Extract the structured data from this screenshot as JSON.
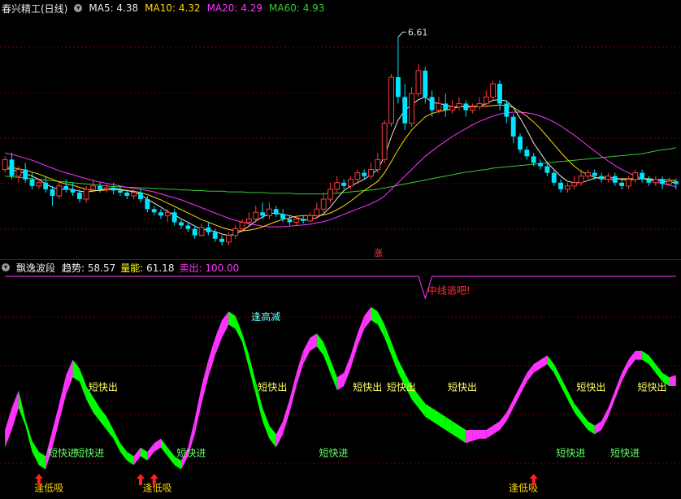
{
  "colors": {
    "bg": "#000000",
    "up": "#ff3b3b",
    "down": "#00e5ff",
    "ma5": "#e8e8e8",
    "ma10": "#ffd700",
    "ma20": "#ff33ff",
    "ma60": "#33cc33",
    "grid": "#7a0000",
    "pink": "#ff33ff",
    "green": "#00ff00"
  },
  "main_panel": {
    "title": "春兴精工(日线)",
    "ma_labels": [
      {
        "label": "MA5: 4.38",
        "color": "#e8e8e8"
      },
      {
        "label": "MA10: 4.32",
        "color": "#ffd700"
      },
      {
        "label": "MA20: 4.29",
        "color": "#ff33ff"
      },
      {
        "label": "MA60: 4.93",
        "color": "#33cc33"
      }
    ],
    "peak_label": "6.61",
    "zhang_label": "涨"
  },
  "sub_panel": {
    "title": "飘逸波段",
    "indicators": [
      {
        "label": "趋势: ",
        "value": "58.57",
        "color": "#ffffff",
        "vcolor": "#e8e8e8"
      },
      {
        "label": "量能: ",
        "value": "61.18",
        "color": "#ffff00",
        "vcolor": "#e8e8e8"
      },
      {
        "label": "卖出: ",
        "value": "100.00",
        "color": "#ff33ff",
        "vcolor": "#ff33ff"
      }
    ]
  },
  "chart_data": {
    "type": "candlestick",
    "peak_value": 6.61,
    "candles": [
      [
        4.6,
        4.75,
        4.55,
        4.8
      ],
      [
        4.75,
        4.5,
        4.45,
        4.85
      ],
      [
        4.5,
        4.6,
        4.4,
        4.65
      ],
      [
        4.6,
        4.45,
        4.4,
        4.7
      ],
      [
        4.45,
        4.35,
        4.3,
        4.55
      ],
      [
        4.35,
        4.4,
        4.3,
        4.45
      ],
      [
        4.4,
        4.3,
        4.25,
        4.5
      ],
      [
        4.3,
        4.2,
        4.05,
        4.35
      ],
      [
        4.2,
        4.35,
        4.15,
        4.4
      ],
      [
        4.35,
        4.3,
        4.25,
        4.45
      ],
      [
        4.3,
        4.25,
        4.2,
        4.4
      ],
      [
        4.25,
        4.15,
        4.1,
        4.3
      ],
      [
        4.15,
        4.3,
        4.1,
        4.35
      ],
      [
        4.3,
        4.35,
        4.25,
        4.45
      ],
      [
        4.35,
        4.3,
        4.25,
        4.4
      ],
      [
        4.3,
        4.32,
        4.25,
        4.38
      ],
      [
        4.32,
        4.28,
        4.22,
        4.4
      ],
      [
        4.28,
        4.25,
        4.2,
        4.35
      ],
      [
        4.25,
        4.2,
        4.15,
        4.3
      ],
      [
        4.2,
        4.25,
        4.15,
        4.3
      ],
      [
        4.25,
        4.15,
        4.1,
        4.3
      ],
      [
        4.15,
        4.0,
        3.95,
        4.2
      ],
      [
        4.0,
        3.95,
        3.9,
        4.05
      ],
      [
        3.95,
        3.9,
        3.85,
        4.0
      ],
      [
        3.9,
        3.95,
        3.8,
        4.0
      ],
      [
        3.95,
        3.8,
        3.75,
        4.0
      ],
      [
        3.8,
        3.75,
        3.7,
        3.85
      ],
      [
        3.75,
        3.7,
        3.65,
        3.8
      ],
      [
        3.7,
        3.6,
        3.55,
        3.75
      ],
      [
        3.6,
        3.72,
        3.58,
        3.78
      ],
      [
        3.72,
        3.65,
        3.6,
        3.8
      ],
      [
        3.65,
        3.55,
        3.5,
        3.7
      ],
      [
        3.55,
        3.5,
        3.45,
        3.6
      ],
      [
        3.5,
        3.6,
        3.45,
        3.65
      ],
      [
        3.6,
        3.7,
        3.55,
        3.75
      ],
      [
        3.7,
        3.8,
        3.65,
        3.85
      ],
      [
        3.8,
        3.85,
        3.75,
        3.95
      ],
      [
        3.85,
        3.95,
        3.8,
        4.05
      ],
      [
        3.95,
        3.9,
        3.85,
        4.1
      ],
      [
        3.9,
        4.0,
        3.85,
        4.1
      ],
      [
        4.0,
        3.92,
        3.88,
        4.05
      ],
      [
        3.92,
        3.85,
        3.8,
        4.0
      ],
      [
        3.85,
        3.8,
        3.75,
        3.9
      ],
      [
        3.8,
        3.85,
        3.75,
        3.9
      ],
      [
        3.85,
        3.82,
        3.78,
        3.9
      ],
      [
        3.82,
        3.9,
        3.8,
        3.95
      ],
      [
        3.9,
        4.0,
        3.85,
        4.1
      ],
      [
        4.0,
        4.15,
        3.95,
        4.25
      ],
      [
        4.15,
        4.3,
        4.1,
        4.4
      ],
      [
        4.3,
        4.4,
        4.25,
        4.5
      ],
      [
        4.4,
        4.35,
        4.3,
        4.45
      ],
      [
        4.35,
        4.45,
        4.3,
        4.5
      ],
      [
        4.45,
        4.55,
        4.4,
        4.6
      ],
      [
        4.55,
        4.5,
        4.45,
        4.6
      ],
      [
        4.5,
        4.6,
        4.45,
        4.7
      ],
      [
        4.6,
        4.75,
        4.55,
        4.85
      ],
      [
        4.75,
        5.3,
        4.7,
        5.35
      ],
      [
        5.3,
        6.0,
        5.25,
        6.05
      ],
      [
        6.0,
        5.7,
        5.6,
        6.61
      ],
      [
        5.7,
        5.3,
        5.2,
        5.9
      ],
      [
        5.3,
        5.75,
        5.25,
        5.85
      ],
      [
        5.75,
        6.1,
        5.7,
        6.2
      ],
      [
        6.1,
        5.7,
        5.6,
        6.15
      ],
      [
        5.7,
        5.5,
        5.4,
        5.8
      ],
      [
        5.5,
        5.6,
        5.45,
        5.7
      ],
      [
        5.6,
        5.5,
        5.4,
        5.75
      ],
      [
        5.5,
        5.55,
        5.45,
        5.65
      ],
      [
        5.55,
        5.6,
        5.5,
        5.7
      ],
      [
        5.6,
        5.5,
        5.4,
        5.65
      ],
      [
        5.5,
        5.55,
        5.45,
        5.6
      ],
      [
        5.55,
        5.6,
        5.5,
        5.7
      ],
      [
        5.6,
        5.7,
        5.55,
        5.8
      ],
      [
        5.7,
        5.9,
        5.65,
        5.95
      ],
      [
        5.9,
        5.6,
        5.5,
        5.95
      ],
      [
        5.6,
        5.4,
        5.3,
        5.65
      ],
      [
        5.4,
        5.1,
        5.0,
        5.45
      ],
      [
        5.1,
        4.9,
        4.85,
        5.15
      ],
      [
        4.9,
        4.8,
        4.75,
        4.95
      ],
      [
        4.8,
        4.7,
        4.65,
        4.85
      ],
      [
        4.7,
        4.65,
        4.6,
        4.75
      ],
      [
        4.65,
        4.55,
        4.5,
        4.7
      ],
      [
        4.55,
        4.4,
        4.35,
        4.6
      ],
      [
        4.4,
        4.3,
        4.25,
        4.45
      ],
      [
        4.3,
        4.35,
        4.25,
        4.4
      ],
      [
        4.35,
        4.4,
        4.3,
        4.5
      ],
      [
        4.4,
        4.5,
        4.35,
        4.6
      ],
      [
        4.5,
        4.55,
        4.45,
        4.6
      ],
      [
        4.55,
        4.5,
        4.45,
        4.6
      ],
      [
        4.5,
        4.45,
        4.4,
        4.55
      ],
      [
        4.45,
        4.5,
        4.4,
        4.55
      ],
      [
        4.5,
        4.4,
        4.35,
        4.55
      ],
      [
        4.4,
        4.35,
        4.3,
        4.45
      ],
      [
        4.35,
        4.45,
        4.3,
        4.5
      ],
      [
        4.45,
        4.55,
        4.4,
        4.6
      ],
      [
        4.55,
        4.45,
        4.4,
        4.6
      ],
      [
        4.45,
        4.4,
        4.35,
        4.5
      ],
      [
        4.4,
        4.45,
        4.35,
        4.5
      ],
      [
        4.45,
        4.38,
        4.3,
        4.5
      ],
      [
        4.38,
        4.42,
        4.35,
        4.48
      ],
      [
        4.42,
        4.38,
        4.3,
        4.46
      ]
    ],
    "ma5": [
      4.62,
      4.6,
      4.57,
      4.54,
      4.5,
      4.45,
      4.38,
      4.33,
      4.3,
      4.3,
      4.3,
      4.27,
      4.26,
      4.27,
      4.29,
      4.31,
      4.32,
      4.3,
      4.28,
      4.26,
      4.22,
      4.15,
      4.09,
      4.03,
      3.96,
      3.91,
      3.85,
      3.8,
      3.74,
      3.7,
      3.68,
      3.66,
      3.62,
      3.6,
      3.62,
      3.67,
      3.74,
      3.82,
      3.88,
      3.93,
      3.94,
      3.92,
      3.9,
      3.87,
      3.84,
      3.84,
      3.87,
      3.93,
      4.03,
      4.16,
      4.28,
      4.35,
      4.4,
      4.45,
      4.52,
      4.6,
      4.8,
      5.1,
      5.35,
      5.5,
      5.58,
      5.66,
      5.7,
      5.62,
      5.6,
      5.58,
      5.55,
      5.55,
      5.55,
      5.55,
      5.56,
      5.6,
      5.65,
      5.66,
      5.64,
      5.54,
      5.38,
      5.2,
      5.0,
      4.85,
      4.7,
      4.6,
      4.5,
      4.42,
      4.4,
      4.4,
      4.43,
      4.47,
      4.48,
      4.48,
      4.47,
      4.45,
      4.44,
      4.45,
      4.46,
      4.45,
      4.44,
      4.42,
      4.41,
      4.4
    ],
    "ma10": [
      4.64,
      4.63,
      4.61,
      4.59,
      4.56,
      4.53,
      4.49,
      4.45,
      4.41,
      4.38,
      4.36,
      4.33,
      4.3,
      4.28,
      4.28,
      4.29,
      4.3,
      4.29,
      4.28,
      4.27,
      4.25,
      4.22,
      4.18,
      4.14,
      4.09,
      4.04,
      3.99,
      3.94,
      3.89,
      3.84,
      3.8,
      3.76,
      3.72,
      3.69,
      3.67,
      3.67,
      3.68,
      3.7,
      3.73,
      3.77,
      3.81,
      3.84,
      3.87,
      3.89,
      3.9,
      3.9,
      3.9,
      3.91,
      3.94,
      3.99,
      4.05,
      4.12,
      4.2,
      4.28,
      4.35,
      4.42,
      4.55,
      4.72,
      4.9,
      5.06,
      5.2,
      5.3,
      5.4,
      5.45,
      5.48,
      5.5,
      5.52,
      5.55,
      5.56,
      5.56,
      5.56,
      5.56,
      5.57,
      5.58,
      5.57,
      5.54,
      5.48,
      5.41,
      5.32,
      5.22,
      5.1,
      4.98,
      4.86,
      4.75,
      4.65,
      4.57,
      4.52,
      4.48,
      4.46,
      4.45,
      4.45,
      4.46,
      4.46,
      4.46,
      4.46,
      4.46,
      4.45,
      4.45,
      4.44,
      4.43
    ],
    "ma20": [
      4.85,
      4.83,
      4.8,
      4.77,
      4.74,
      4.7,
      4.66,
      4.62,
      4.58,
      4.55,
      4.52,
      4.49,
      4.46,
      4.43,
      4.41,
      4.39,
      4.37,
      4.35,
      4.33,
      4.31,
      4.3,
      4.28,
      4.26,
      4.23,
      4.2,
      4.17,
      4.14,
      4.1,
      4.06,
      4.02,
      3.98,
      3.94,
      3.9,
      3.86,
      3.83,
      3.8,
      3.78,
      3.76,
      3.74,
      3.73,
      3.73,
      3.73,
      3.74,
      3.75,
      3.76,
      3.77,
      3.79,
      3.81,
      3.84,
      3.88,
      3.92,
      3.96,
      4.0,
      4.04,
      4.08,
      4.13,
      4.2,
      4.3,
      4.4,
      4.5,
      4.6,
      4.7,
      4.8,
      4.88,
      4.96,
      5.03,
      5.1,
      5.16,
      5.22,
      5.28,
      5.33,
      5.37,
      5.41,
      5.44,
      5.46,
      5.47,
      5.47,
      5.46,
      5.44,
      5.41,
      5.37,
      5.32,
      5.26,
      5.19,
      5.12,
      5.04,
      4.96,
      4.88,
      4.8,
      4.73,
      4.66,
      4.6,
      4.55,
      4.5,
      4.47,
      4.44,
      4.41,
      4.39,
      4.36,
      4.34
    ],
    "ma60": [
      4.5,
      4.49,
      4.48,
      4.47,
      4.46,
      4.45,
      4.44,
      4.43,
      4.42,
      4.41,
      4.4,
      4.39,
      4.38,
      4.37,
      4.36,
      4.35,
      4.34,
      4.34,
      4.33,
      4.33,
      4.32,
      4.32,
      4.31,
      4.31,
      4.3,
      4.3,
      4.29,
      4.29,
      4.28,
      4.28,
      4.27,
      4.27,
      4.27,
      4.26,
      4.26,
      4.26,
      4.25,
      4.25,
      4.25,
      4.24,
      4.24,
      4.24,
      4.24,
      4.23,
      4.23,
      4.23,
      4.23,
      4.23,
      4.24,
      4.24,
      4.25,
      4.26,
      4.27,
      4.28,
      4.29,
      4.3,
      4.32,
      4.34,
      4.36,
      4.38,
      4.4,
      4.42,
      4.44,
      4.46,
      4.48,
      4.5,
      4.52,
      4.54,
      4.56,
      4.57,
      4.59,
      4.6,
      4.62,
      4.63,
      4.64,
      4.65,
      4.66,
      4.67,
      4.68,
      4.69,
      4.7,
      4.71,
      4.72,
      4.73,
      4.74,
      4.75,
      4.76,
      4.77,
      4.78,
      4.79,
      4.8,
      4.81,
      4.82,
      4.83,
      4.84,
      4.86,
      4.88,
      4.9,
      4.91,
      4.93
    ],
    "y_range": [
      3.3,
      6.9
    ],
    "indicator": {
      "y_range": [
        0,
        100
      ],
      "trend": [
        30,
        40,
        48,
        35,
        25,
        20,
        18,
        30,
        42,
        55,
        62,
        58,
        50,
        45,
        40,
        36,
        30,
        24,
        20,
        18,
        22,
        20,
        24,
        26,
        22,
        18,
        16,
        22,
        35,
        50,
        62,
        72,
        80,
        84,
        82,
        74,
        64,
        52,
        40,
        32,
        28,
        34,
        44,
        56,
        66,
        72,
        74,
        70,
        62,
        54,
        56,
        64,
        74,
        82,
        86,
        84,
        78,
        70,
        62,
        56,
        50,
        46,
        42,
        40,
        38,
        36,
        34,
        32,
        30,
        30,
        30,
        30,
        32,
        34,
        38,
        44,
        50,
        56,
        60,
        62,
        64,
        60,
        54,
        48,
        42,
        38,
        34,
        32,
        34,
        40,
        48,
        56,
        62,
        66,
        66,
        64,
        60,
        56,
        54,
        55
      ],
      "energy": [
        22,
        30,
        40,
        32,
        20,
        14,
        12,
        22,
        34,
        46,
        54,
        52,
        44,
        38,
        34,
        30,
        26,
        20,
        16,
        14,
        18,
        16,
        20,
        22,
        18,
        14,
        12,
        18,
        28,
        42,
        54,
        64,
        72,
        78,
        76,
        70,
        58,
        46,
        34,
        26,
        22,
        28,
        38,
        50,
        60,
        66,
        68,
        64,
        56,
        48,
        50,
        58,
        68,
        76,
        80,
        78,
        72,
        64,
        56,
        50,
        44,
        40,
        36,
        34,
        32,
        30,
        28,
        26,
        24,
        25,
        26,
        26,
        28,
        30,
        34,
        40,
        46,
        52,
        56,
        58,
        60,
        56,
        50,
        44,
        38,
        34,
        30,
        28,
        30,
        36,
        44,
        52,
        58,
        62,
        62,
        60,
        56,
        52,
        50,
        50
      ],
      "sell_line": [
        100,
        100,
        100,
        100,
        100,
        100,
        100,
        100,
        100,
        100,
        100,
        100,
        100,
        100,
        100,
        100,
        100,
        100,
        100,
        100,
        100,
        100,
        100,
        100,
        100,
        100,
        100,
        100,
        100,
        100,
        100,
        100,
        100,
        100,
        100,
        100,
        100,
        100,
        100,
        100,
        100,
        100,
        100,
        100,
        100,
        100,
        100,
        100,
        100,
        100,
        100,
        100,
        100,
        100,
        100,
        100,
        100,
        100,
        100,
        100,
        100,
        100,
        90,
        100,
        100,
        100,
        100,
        100,
        100,
        100,
        100,
        100,
        100,
        100,
        100,
        100,
        100,
        100,
        100,
        100,
        100,
        100,
        100,
        100,
        100,
        100,
        100,
        100,
        100,
        100,
        100,
        100,
        100,
        100,
        100,
        100,
        100,
        100,
        100,
        100
      ],
      "annotations": [
        {
          "text": "短快出",
          "x_index": 14,
          "y": 48,
          "color": "#ffff66"
        },
        {
          "text": "短快出",
          "x_index": 39,
          "y": 48,
          "color": "#ffff66"
        },
        {
          "text": "短快出",
          "x_index": 53,
          "y": 48,
          "color": "#ffff66"
        },
        {
          "text": "短快出",
          "x_index": 58,
          "y": 48,
          "color": "#ffff66"
        },
        {
          "text": "短快出",
          "x_index": 67,
          "y": 48,
          "color": "#ffff66"
        },
        {
          "text": "短快出",
          "x_index": 86,
          "y": 48,
          "color": "#ffff66"
        },
        {
          "text": "短快出",
          "x_index": 95,
          "y": 48,
          "color": "#ffff66"
        },
        {
          "text": "逢高减",
          "x_index": 38,
          "y": 80,
          "color": "#66ffff"
        },
        {
          "text": "短快进",
          "x_index": 8,
          "y": 18,
          "color": "#66ff66"
        },
        {
          "text": "短快进",
          "x_index": 12,
          "y": 18,
          "color": "#66ff66"
        },
        {
          "text": "短快进",
          "x_index": 27,
          "y": 18,
          "color": "#66ff66"
        },
        {
          "text": "短快进",
          "x_index": 48,
          "y": 18,
          "color": "#66ff66"
        },
        {
          "text": "短快进",
          "x_index": 83,
          "y": 18,
          "color": "#66ff66"
        },
        {
          "text": "短快进",
          "x_index": 91,
          "y": 18,
          "color": "#66ff66"
        },
        {
          "text": "逢低吸",
          "x_index": 6,
          "y": 2,
          "color": "#ffd700"
        },
        {
          "text": "逢低吸",
          "x_index": 22,
          "y": 2,
          "color": "#ffd700"
        },
        {
          "text": "逢低吸",
          "x_index": 76,
          "y": 2,
          "color": "#ffd700"
        },
        {
          "text": "中线逃吧!",
          "x_index": 64,
          "y": 92,
          "color": "#ff3333"
        }
      ],
      "arrows_up": [
        5,
        20,
        22,
        78
      ]
    }
  }
}
